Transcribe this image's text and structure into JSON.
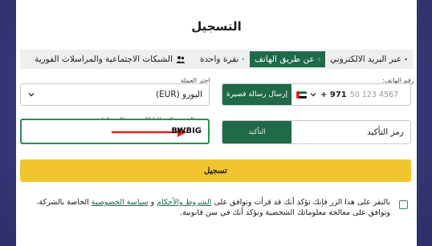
{
  "title": "التسجيل",
  "tabs": [
    {
      "label": "عبر البريد الالكتروني",
      "icon": "email-icon",
      "active": false
    },
    {
      "label": "عن طريق الهاتف",
      "icon": "phone-icon",
      "active": true
    },
    {
      "label": "نقرة واحدة",
      "icon": "lightning-icon",
      "active": false
    },
    {
      "label": "الشبكات الاجتماعية والمراسلات الفورية",
      "icon": "users-icon",
      "active": false
    }
  ],
  "currency": {
    "label": "اختر العملة",
    "value": "اليورو (EUR)"
  },
  "phone": {
    "label": "رقم الهاتف:",
    "country_code": "+ 971",
    "placeholder": "50 123 4567",
    "sms_button": "إرسال رسالة قصيرة"
  },
  "promo": {
    "label": "البرومو كود (إذا كان موجودًا عندك)",
    "value": "BWBIG"
  },
  "confirm": {
    "placeholder": "رمز التأكيد",
    "button": "التأكيد"
  },
  "register_button": "تسجيل",
  "terms": {
    "prefix": "بالنقر على هذا الزر فإنك تؤكد أنك قد قرأت وتوافق على ",
    "terms_link": "الشروط والأحكام",
    "and": " و ",
    "privacy_link": "سياسة الخصوصية",
    "suffix": " الخاصة بالشركة، وتوافق على معالجة معلوماتك الشخصية وتؤكد أنك في سن قانونية."
  },
  "colors": {
    "accent": "#1f6a48",
    "button": "#f2c52e",
    "background": "#403f86",
    "arrow": "#e02020"
  }
}
